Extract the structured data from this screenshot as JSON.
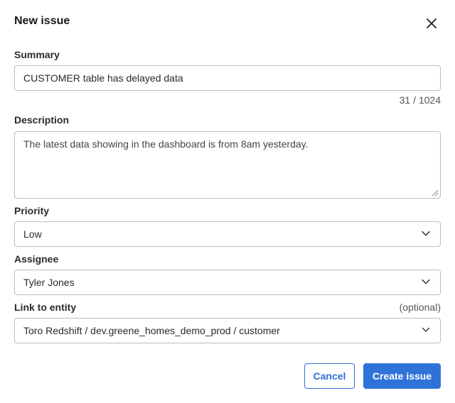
{
  "dialog": {
    "title": "New issue"
  },
  "summary": {
    "label": "Summary",
    "value": "CUSTOMER table has delayed data",
    "counter": "31 / 1024"
  },
  "description": {
    "label": "Description",
    "value": "The latest data showing in the dashboard is from 8am yesterday."
  },
  "priority": {
    "label": "Priority",
    "selected": "Low"
  },
  "assignee": {
    "label": "Assignee",
    "selected": "Tyler Jones"
  },
  "link_entity": {
    "label": "Link to entity",
    "hint": "(optional)",
    "selected": "Toro Redshift / dev.greene_homes_demo_prod / customer"
  },
  "actions": {
    "cancel_label": "Cancel",
    "create_label": "Create issue"
  },
  "colors": {
    "primary": "#2f73d9",
    "border": "#b8bcc2"
  }
}
